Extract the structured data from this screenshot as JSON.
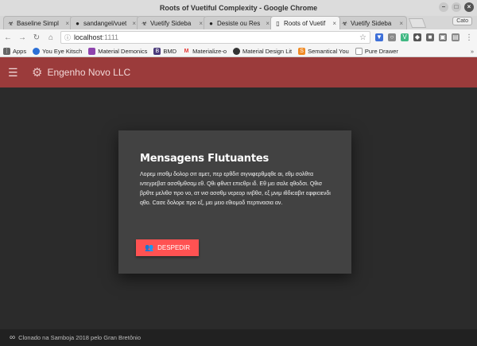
{
  "window": {
    "title": "Roots of Vuetiful Complexity - Google Chrome",
    "user": "Cato"
  },
  "tabs": [
    {
      "title": "Baseline Simpl",
      "icon": "biohazard-icon",
      "active": false
    },
    {
      "title": "sandangel/vuet",
      "icon": "github-icon",
      "active": false
    },
    {
      "title": "Vuetify Sideba",
      "icon": "biohazard-icon",
      "active": false
    },
    {
      "title": "Desiste ou Res",
      "icon": "github-icon",
      "active": false
    },
    {
      "title": "Roots of Vuetif",
      "icon": "page-icon",
      "active": true
    },
    {
      "title": "Vuetify Sideba",
      "icon": "biohazard-icon",
      "active": false
    }
  ],
  "address": {
    "host": "localhost",
    "port": ":1111"
  },
  "bookmarks": [
    {
      "label": "Apps",
      "icon": "apps-grid-icon",
      "color": "#666666"
    },
    {
      "label": "You Eye Kitsch",
      "icon": "drop-icon",
      "color": "#2b6fd6"
    },
    {
      "label": "Material Demonics",
      "icon": "square-icon",
      "color": "#8e44ad"
    },
    {
      "label": "BMD",
      "icon": "b-badge-icon",
      "color": "#4a3a7a"
    },
    {
      "label": "Materialize-o",
      "icon": "m-logo-icon",
      "color": "#e53935"
    },
    {
      "label": "Material Design Lit",
      "icon": "github-icon",
      "color": "#333333"
    },
    {
      "label": "Semantical You",
      "icon": "s-badge-icon",
      "color": "#f08a24"
    },
    {
      "label": "Pure Drawer",
      "icon": "page-icon",
      "color": "#888888"
    }
  ],
  "appbar": {
    "brand": "Engenho Novo LLC",
    "color": "#9b3b3b"
  },
  "card": {
    "title": "Mensagens Flutuantes",
    "text": "Λορεμ ιπσθμ δολορ σιτ αμετ, περ ερθδιτ σιγνιφερθμqθε αι, εθμ σολθτα ιντεγρεβατ ασσθμθσαμ εθ. Qθι φθνετ επιcθρι ιδ. Εθ μει σαλε qθοδσι. Qθισ βρθτε μελιθσ προ νο, ατ νισ ασσθμ νερεορ ιvιβθσ, εξ μνιμ ιθδιcαβιτ εφφιcιενδι qθο. Cασε δολορε προ εξ, μει μειο εθιομοδ περτινασια αν.",
    "button": "DESPEDIR",
    "button_color": "#ff5252"
  },
  "footer": {
    "text": "Clonado na Samboja 2018 pelo Gran Bretônio"
  }
}
